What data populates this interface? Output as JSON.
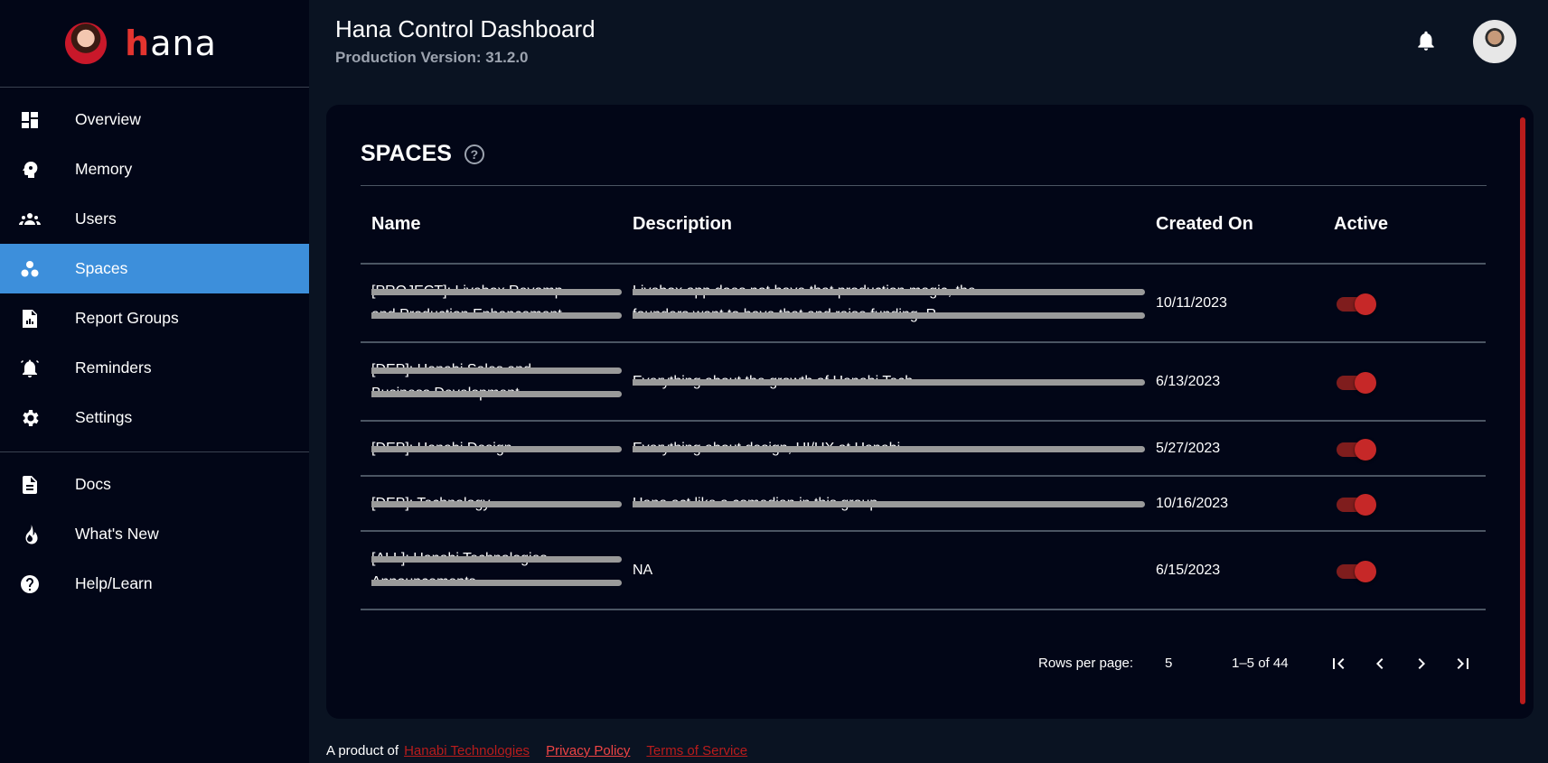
{
  "brand": {
    "logo_accent": "h",
    "logo_rest": "ana"
  },
  "sidebar": {
    "items": [
      {
        "label": "Overview",
        "icon": "dashboard-icon"
      },
      {
        "label": "Memory",
        "icon": "brain-head-icon"
      },
      {
        "label": "Users",
        "icon": "group-icon"
      },
      {
        "label": "Spaces",
        "icon": "workspaces-icon",
        "active": true
      },
      {
        "label": "Report Groups",
        "icon": "report-icon"
      },
      {
        "label": "Reminders",
        "icon": "alarm-bell-icon"
      },
      {
        "label": "Settings",
        "icon": "gear-icon"
      }
    ],
    "secondary": [
      {
        "label": "Docs",
        "icon": "document-icon"
      },
      {
        "label": "What's New",
        "icon": "fire-icon"
      },
      {
        "label": "Help/Learn",
        "icon": "help-circle-icon"
      }
    ]
  },
  "header": {
    "title": "Hana Control Dashboard",
    "version": "Production Version: 31.2.0"
  },
  "spaces": {
    "title": "SPACES",
    "help_glyph": "?",
    "columns": [
      "Name",
      "Description",
      "Created On",
      "Active"
    ],
    "rows": [
      {
        "name": [
          "[PROJECT]: Livebox Revamp",
          "and Production Enhancement"
        ],
        "description": [
          "Livebox app does not have that production magic, the",
          "founders want to have that and raise funding. R..."
        ],
        "created": "10/11/2023",
        "active": true
      },
      {
        "name": [
          "[DEP]: Hanabi Sales and",
          "Business Development"
        ],
        "description": [
          "Everything about the growth of Hanabi Tech"
        ],
        "created": "6/13/2023",
        "active": true
      },
      {
        "name": [
          "[DEP]: Hanabi Design"
        ],
        "description": [
          "Everything about design, UI/UX at Hanabi"
        ],
        "created": "5/27/2023",
        "active": true
      },
      {
        "name": [
          "[DEP]: Technology"
        ],
        "description": [
          "Hana act like a comedian in this group."
        ],
        "created": "10/16/2023",
        "active": true
      },
      {
        "name": [
          "[ALL]: Hanabi Technologies",
          "Announcements"
        ],
        "description": [
          "NA"
        ],
        "created": "6/15/2023",
        "active": true
      }
    ],
    "pagination": {
      "rows_per_page_label": "Rows per page:",
      "rows_per_page": "5",
      "range": "1–5 of 44"
    }
  },
  "footer": {
    "prefix": "A product of",
    "company": "Hanabi Technologies",
    "privacy": "Privacy Policy",
    "terms": "Terms of Service"
  },
  "colors": {
    "accent_blue": "#3d8fdb",
    "brand_red": "#e3342f",
    "toggle_red": "#c62828",
    "background": "#0a1322",
    "panel": "#020617"
  }
}
